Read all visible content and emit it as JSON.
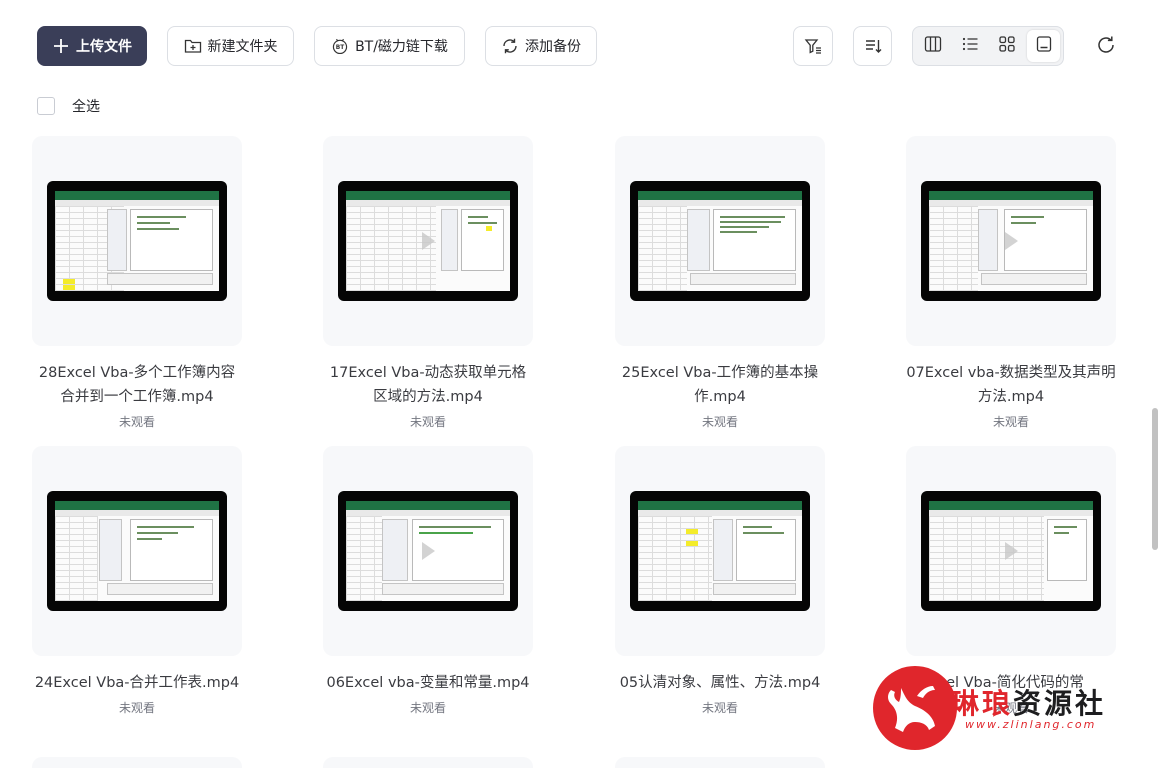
{
  "toolbar": {
    "upload_label": "上传文件",
    "new_folder_label": "新建文件夹",
    "bt_label": "BT/磁力链下载",
    "backup_label": "添加备份"
  },
  "select_all_label": "全选",
  "files": [
    {
      "name": "28Excel Vba-多个工作簿内容合并到一个工作簿.mp4",
      "status": "未观看"
    },
    {
      "name": "17Excel Vba-动态获取单元格区域的方法.mp4",
      "status": "未观看"
    },
    {
      "name": "25Excel Vba-工作簿的基本操作.mp4",
      "status": "未观看"
    },
    {
      "name": "07Excel vba-数据类型及其声明方法.mp4",
      "status": "未观看"
    },
    {
      "name": "24Excel Vba-合并工作表.mp4",
      "status": "未观看"
    },
    {
      "name": "06Excel vba-变量和常量.mp4",
      "status": "未观看"
    },
    {
      "name": "05认清对象、属性、方法.mp4",
      "status": "未观看"
    },
    {
      "name": "cel Vba-简化代码的常",
      "status": "未观看"
    }
  ],
  "watermark": {
    "text_red": "琳琅",
    "text_dark": "资源社",
    "url": "www.zlinlang.com"
  },
  "colors": {
    "primary_button": "#3a3e58",
    "excel_green": "#1f7244",
    "watermark_red": "#e0262c"
  }
}
